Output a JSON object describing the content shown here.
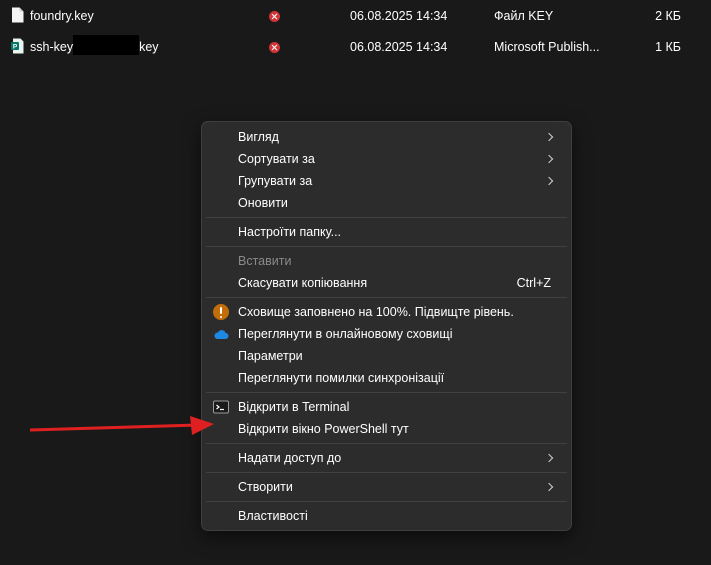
{
  "files": [
    {
      "name": "foundry.key",
      "date": "06.08.2025 14:34",
      "type": "Файл KEY",
      "size": "2 КБ",
      "icon": "document-icon"
    },
    {
      "name_prefix": "ssh-key",
      "name_suffix": "key",
      "date": "06.08.2025 14:34",
      "type": "Microsoft Publish...",
      "size": "1 КБ",
      "icon": "publisher-icon"
    }
  ],
  "menu": {
    "view": "Вигляд",
    "sort_by": "Сортувати за",
    "group_by": "Групувати за",
    "refresh": "Оновити",
    "customize_folder": "Настроїти папку...",
    "paste": "Вставити",
    "undo_copy": "Скасувати копіювання",
    "undo_shortcut": "Ctrl+Z",
    "storage_full": "Сховище заповнено на 100%. Підвищте рівень.",
    "view_online": "Переглянути в онлайновому сховищі",
    "settings": "Параметри",
    "view_sync_errors": "Переглянути помилки синхронізації",
    "open_terminal": "Відкрити в Terminal",
    "open_powershell": "Відкрити вікно PowerShell тут",
    "give_access": "Надати доступ до",
    "new": "Створити",
    "properties": "Властивості"
  },
  "colors": {
    "background": "#191919",
    "menu_background": "#2c2c2c",
    "error": "#d13438",
    "warning": "#c16e0a",
    "onedrive": "#1e88e5",
    "arrow": "#e02020"
  }
}
